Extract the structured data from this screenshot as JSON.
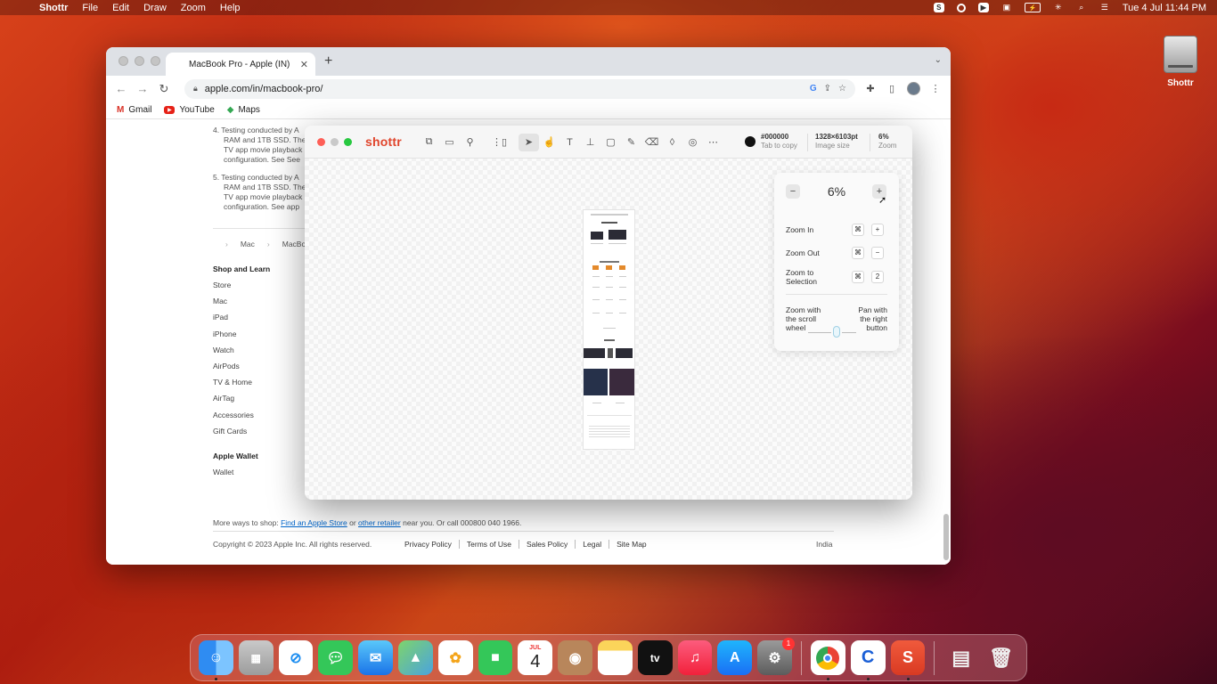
{
  "menubar": {
    "app_name": "Shottr",
    "menus": [
      "File",
      "Edit",
      "Draw",
      "Zoom",
      "Help"
    ],
    "status_s": "S",
    "clock": "Tue 4 Jul  11:44 PM"
  },
  "desktop": {
    "icon_label": "Shottr"
  },
  "browser": {
    "tab_title": "MacBook Pro - Apple (IN)",
    "url": "apple.com/in/macbook-pro/",
    "bookmarks": [
      "Gmail",
      "YouTube",
      "Maps"
    ]
  },
  "page": {
    "footnote4": [
      "4.  Testing conducted by A",
      "RAM and 1TB SSD. The",
      "TV app movie playback",
      "configuration. See See"
    ],
    "footnote5": [
      "5.  Testing conducted by A",
      "RAM and 1TB SSD. The",
      "TV app movie playback",
      "configuration. See app"
    ],
    "breadcrumbs": [
      "Mac",
      "MacBo"
    ],
    "shop_heading": "Shop and Learn",
    "shop_items": [
      "Store",
      "Mac",
      "iPad",
      "iPhone",
      "Watch",
      "AirPods",
      "TV & Home",
      "AirTag",
      "Accessories",
      "Gift Cards"
    ],
    "wallet_heading": "Apple Wallet",
    "wallet_items": [
      "Wallet"
    ],
    "more_prefix": "More ways to shop: ",
    "more_link1": "Find an Apple Store",
    "more_mid": " or ",
    "more_link2": "other retailer",
    "more_suffix": " near you. Or call 000800 040 1966.",
    "copyright": "Copyright © 2023 Apple Inc. All rights reserved.",
    "legal_links": [
      "Privacy Policy",
      "Terms of Use",
      "Sales Policy",
      "Legal",
      "Site Map"
    ],
    "country": "India"
  },
  "shottr": {
    "logo": "shottr",
    "color_value": "#000000",
    "color_hint": "Tab to copy",
    "image_size": "1328×6103pt",
    "image_size_label": "Image size",
    "zoom_value": "6%",
    "zoom_label": "Zoom",
    "popover": {
      "zoom_display": "6%",
      "minus": "−",
      "plus": "+",
      "zoom_in": "Zoom In",
      "zoom_in_keys": [
        "⌘",
        "+"
      ],
      "zoom_out": "Zoom Out",
      "zoom_out_keys": [
        "⌘",
        "−"
      ],
      "zoom_sel_1": "Zoom to",
      "zoom_sel_2": "Selection",
      "zoom_sel_keys": [
        "⌘",
        "2"
      ],
      "scroll_1": "Zoom with",
      "scroll_2": "the scroll",
      "scroll_3": "wheel",
      "pan_1": "Pan with",
      "pan_2": "the right",
      "pan_3": "button"
    }
  },
  "dock": {
    "calendar_month": "JUL",
    "calendar_day": "4",
    "settings_badge": "1"
  }
}
